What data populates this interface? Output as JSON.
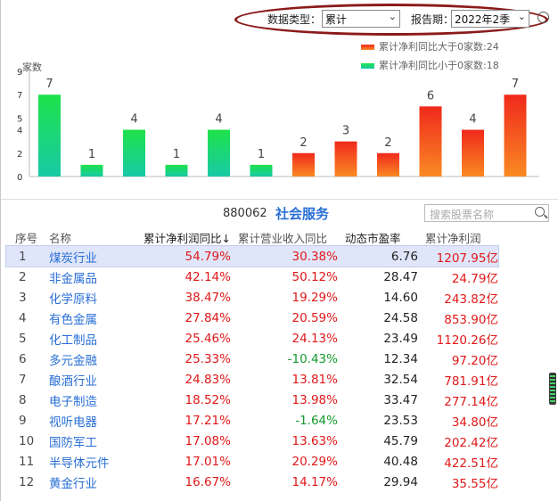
{
  "toolbar": {
    "data_type_label": "数据类型：",
    "data_type_value": "累计",
    "report_period_label": "报告期：",
    "report_period_value": "2022年2季"
  },
  "legend": {
    "up_label": "累计净利同比大于0家数:24",
    "down_label": "累计净利同比小于0家数:18",
    "up_color": "#e8321f",
    "down_color": "#1fd34a"
  },
  "chart_data": {
    "type": "bar",
    "ylabel": "家数",
    "yticks": [
      0,
      2,
      4,
      5,
      7,
      9
    ],
    "ylim": [
      0,
      9
    ],
    "series": [
      {
        "name": "累计净利同比小于0家数",
        "values": [
          7,
          1,
          4,
          1,
          4,
          1
        ]
      },
      {
        "name": "累计净利同比大于0家数",
        "values": [
          2,
          3,
          2,
          6,
          4,
          7
        ]
      }
    ],
    "values": [
      7,
      1,
      4,
      1,
      4,
      1,
      2,
      3,
      2,
      6,
      4,
      7
    ],
    "colors": [
      "green",
      "green",
      "green",
      "green",
      "green",
      "green",
      "red",
      "red",
      "red",
      "red",
      "red",
      "red"
    ]
  },
  "sector": {
    "code": "880062",
    "name": "社会服务",
    "search_placeholder": "搜索股票名称"
  },
  "table": {
    "headers": [
      "序号",
      "名称",
      "累计净利润同比↓",
      "累计营业收入同比",
      "动态市盈率",
      "累计净利润"
    ],
    "rows": [
      {
        "no": "1",
        "name": "煤炭行业",
        "np_yoy": "54.79%",
        "rev_yoy": "30.38%",
        "rev_dir": "up",
        "pe": "6.76",
        "np": "1207.95亿"
      },
      {
        "no": "2",
        "name": "非金属品",
        "np_yoy": "42.14%",
        "rev_yoy": "50.12%",
        "rev_dir": "up",
        "pe": "28.47",
        "np": "24.79亿"
      },
      {
        "no": "3",
        "name": "化学原料",
        "np_yoy": "38.47%",
        "rev_yoy": "19.29%",
        "rev_dir": "up",
        "pe": "14.60",
        "np": "243.82亿"
      },
      {
        "no": "4",
        "name": "有色金属",
        "np_yoy": "27.84%",
        "rev_yoy": "20.59%",
        "rev_dir": "up",
        "pe": "24.58",
        "np": "853.90亿"
      },
      {
        "no": "5",
        "name": "化工制品",
        "np_yoy": "25.46%",
        "rev_yoy": "24.13%",
        "rev_dir": "up",
        "pe": "23.49",
        "np": "1120.26亿"
      },
      {
        "no": "6",
        "name": "多元金融",
        "np_yoy": "25.33%",
        "rev_yoy": "-10.43%",
        "rev_dir": "down",
        "pe": "12.34",
        "np": "97.20亿"
      },
      {
        "no": "7",
        "name": "酿酒行业",
        "np_yoy": "24.83%",
        "rev_yoy": "13.81%",
        "rev_dir": "up",
        "pe": "32.54",
        "np": "781.91亿"
      },
      {
        "no": "8",
        "name": "电子制造",
        "np_yoy": "18.52%",
        "rev_yoy": "13.98%",
        "rev_dir": "up",
        "pe": "33.47",
        "np": "277.14亿"
      },
      {
        "no": "9",
        "name": "视听电器",
        "np_yoy": "17.21%",
        "rev_yoy": "-1.64%",
        "rev_dir": "down",
        "pe": "23.53",
        "np": "34.80亿"
      },
      {
        "no": "10",
        "name": "国防军工",
        "np_yoy": "17.08%",
        "rev_yoy": "13.63%",
        "rev_dir": "up",
        "pe": "45.79",
        "np": "202.42亿"
      },
      {
        "no": "11",
        "name": "半导体元件",
        "np_yoy": "17.01%",
        "rev_yoy": "20.29%",
        "rev_dir": "up",
        "pe": "40.48",
        "np": "422.51亿"
      },
      {
        "no": "12",
        "name": "黄金行业",
        "np_yoy": "16.67%",
        "rev_yoy": "14.17%",
        "rev_dir": "up",
        "pe": "29.94",
        "np": "35.55亿"
      }
    ],
    "selected_row": 0
  }
}
